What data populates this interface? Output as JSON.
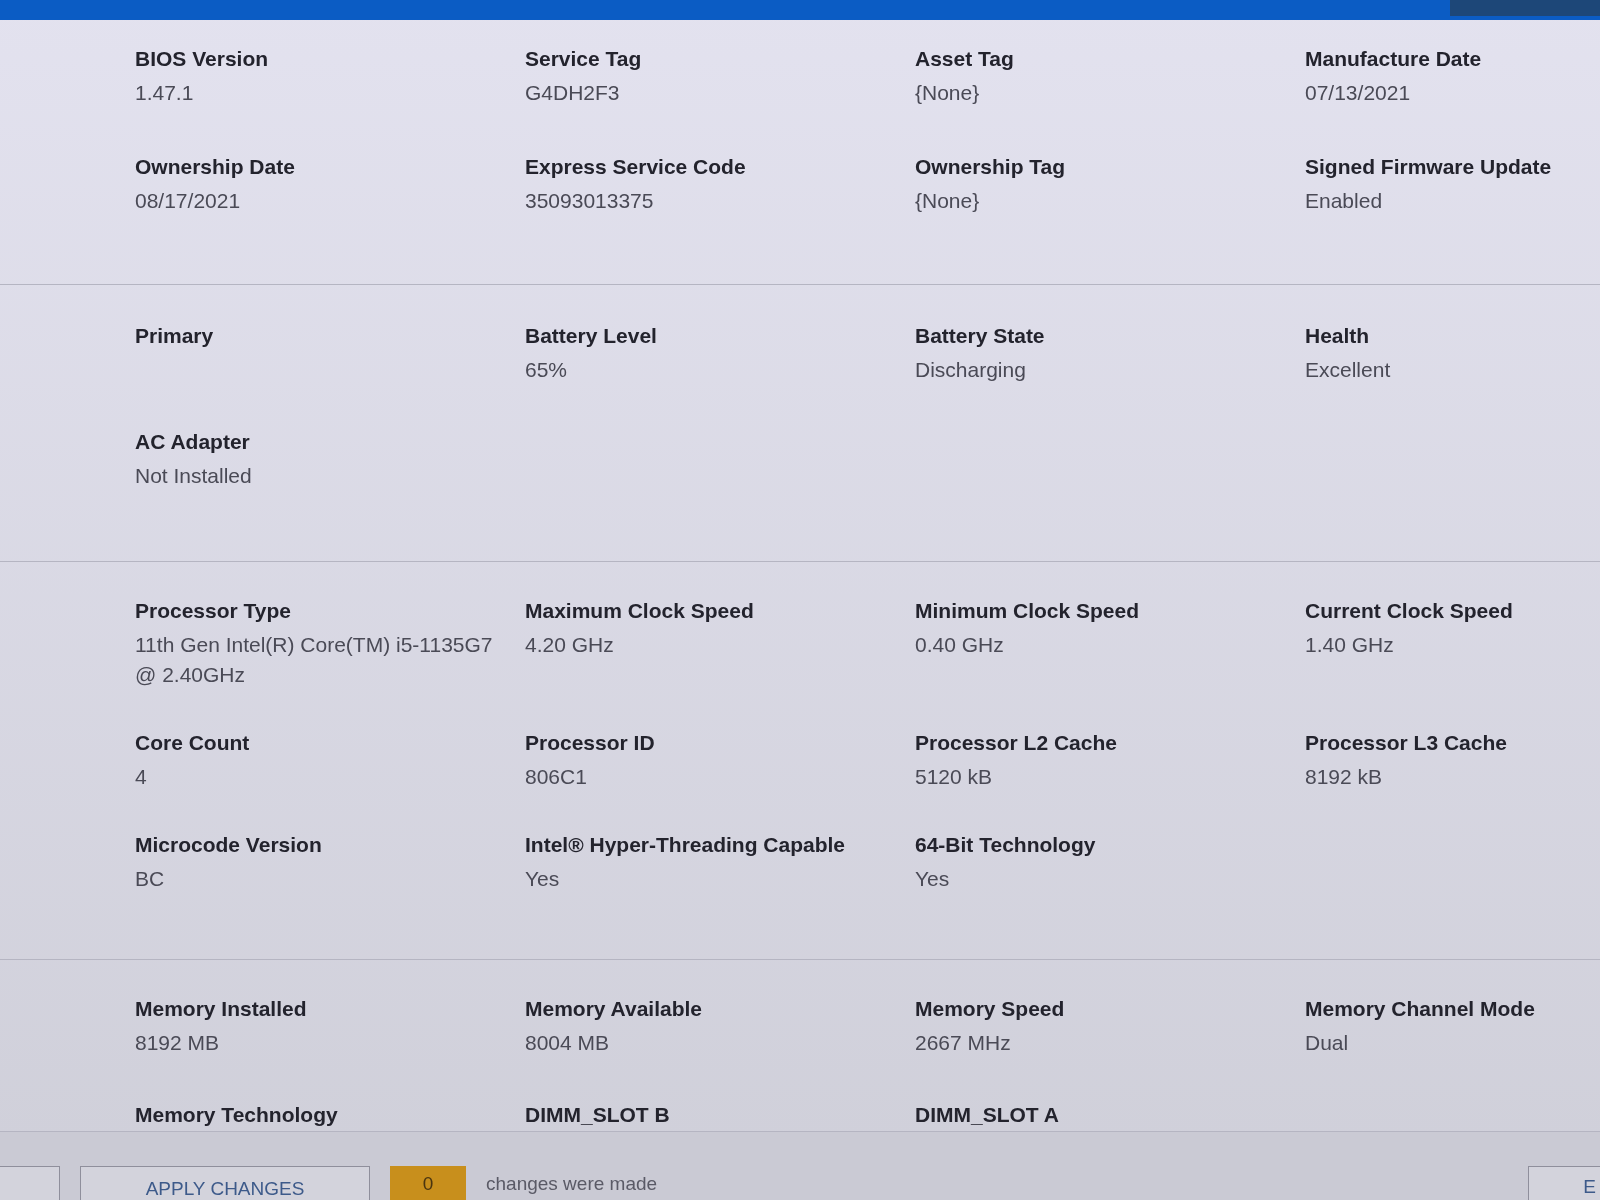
{
  "sections": [
    {
      "fields": [
        {
          "label": "BIOS Version",
          "value": "1.47.1"
        },
        {
          "label": "Service Tag",
          "value": "G4DH2F3"
        },
        {
          "label": "Asset Tag",
          "value": "{None}"
        },
        {
          "label": "Manufacture Date",
          "value": "07/13/2021"
        },
        {
          "label": "Ownership Date",
          "value": "08/17/2021"
        },
        {
          "label": "Express Service Code",
          "value": "35093013375"
        },
        {
          "label": "Ownership Tag",
          "value": "{None}"
        },
        {
          "label": "Signed Firmware Update",
          "value": "Enabled"
        }
      ]
    },
    {
      "fields": [
        {
          "label": "Primary"
        },
        {
          "label": "Battery Level",
          "value": "65%"
        },
        {
          "label": "Battery State",
          "value": "Discharging"
        },
        {
          "label": "Health",
          "value": "Excellent"
        },
        {
          "label": "AC Adapter",
          "value": "Not Installed"
        }
      ]
    },
    {
      "fields": [
        {
          "label": "Processor Type",
          "value": "11th Gen Intel(R) Core(TM) i5-1135G7 @ 2.40GHz"
        },
        {
          "label": "Maximum Clock Speed",
          "value": "4.20 GHz"
        },
        {
          "label": "Minimum Clock Speed",
          "value": "0.40 GHz"
        },
        {
          "label": "Current Clock Speed",
          "value": "1.40 GHz"
        },
        {
          "label": "Core Count",
          "value": "4"
        },
        {
          "label": "Processor ID",
          "value": "806C1"
        },
        {
          "label": "Processor L2 Cache",
          "value": "5120 kB"
        },
        {
          "label": "Processor L3 Cache",
          "value": "8192 kB"
        },
        {
          "label": "Microcode Version",
          "value": "BC"
        },
        {
          "label": "Intel® Hyper-Threading Capable",
          "value": "Yes"
        },
        {
          "label": "64-Bit Technology",
          "value": "Yes"
        }
      ]
    },
    {
      "fields": [
        {
          "label": "Memory Installed",
          "value": "8192 MB"
        },
        {
          "label": "Memory Available",
          "value": "8004 MB"
        },
        {
          "label": "Memory Speed",
          "value": "2667 MHz"
        },
        {
          "label": "Memory Channel Mode",
          "value": "Dual"
        },
        {
          "label": "Memory Technology"
        },
        {
          "label": "DIMM_SLOT B"
        },
        {
          "label": "DIMM_SLOT A"
        }
      ]
    }
  ],
  "footer": {
    "apply_button": "APPLY CHANGES",
    "changes_count": "0",
    "changes_text": "changes were made",
    "right_button": "E"
  }
}
